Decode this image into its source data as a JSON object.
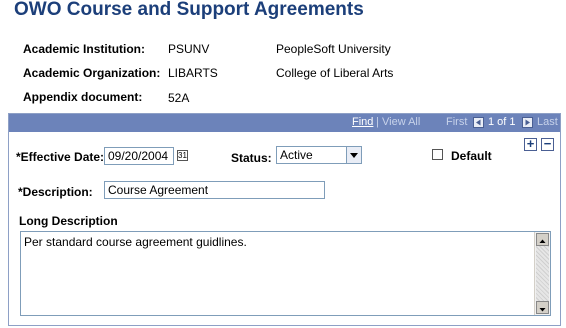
{
  "page": {
    "title": "OWO Course and Support Agreements"
  },
  "info": {
    "academic_institution": {
      "label": "Academic Institution:",
      "code": "PSUNV",
      "description": "PeopleSoft University"
    },
    "academic_organization": {
      "label": "Academic Organization:",
      "code": "LIBARTS",
      "description": "College of Liberal Arts"
    },
    "appendix_document": {
      "label": "Appendix document:",
      "value": "52A"
    }
  },
  "grid": {
    "find_label": "Find",
    "separator": "|",
    "view_all_label": "View All",
    "first_label": "First",
    "page_status": "1 of 1",
    "last_label": "Last"
  },
  "form": {
    "effective_date": {
      "label": "*Effective Date:",
      "value": "09/20/2004"
    },
    "status": {
      "label": "Status:",
      "value": "Active"
    },
    "default": {
      "label": "Default",
      "checked": false
    },
    "description": {
      "label": "*Description:",
      "value": "Course Agreement"
    },
    "long_description": {
      "label": "Long Description",
      "value": "Per standard course agreement guidlines."
    }
  },
  "icons": {
    "calendar": "calendar-icon",
    "prev": "arrow-left-icon",
    "next": "arrow-right-icon",
    "add": "plus-icon",
    "delete": "minus-icon",
    "scroll_up": "arrow-up-icon",
    "scroll_down": "arrow-down-icon"
  },
  "colors": {
    "title": "#1c3f7a",
    "grid_header": "#6c83ba",
    "border": "#7f9db9"
  }
}
